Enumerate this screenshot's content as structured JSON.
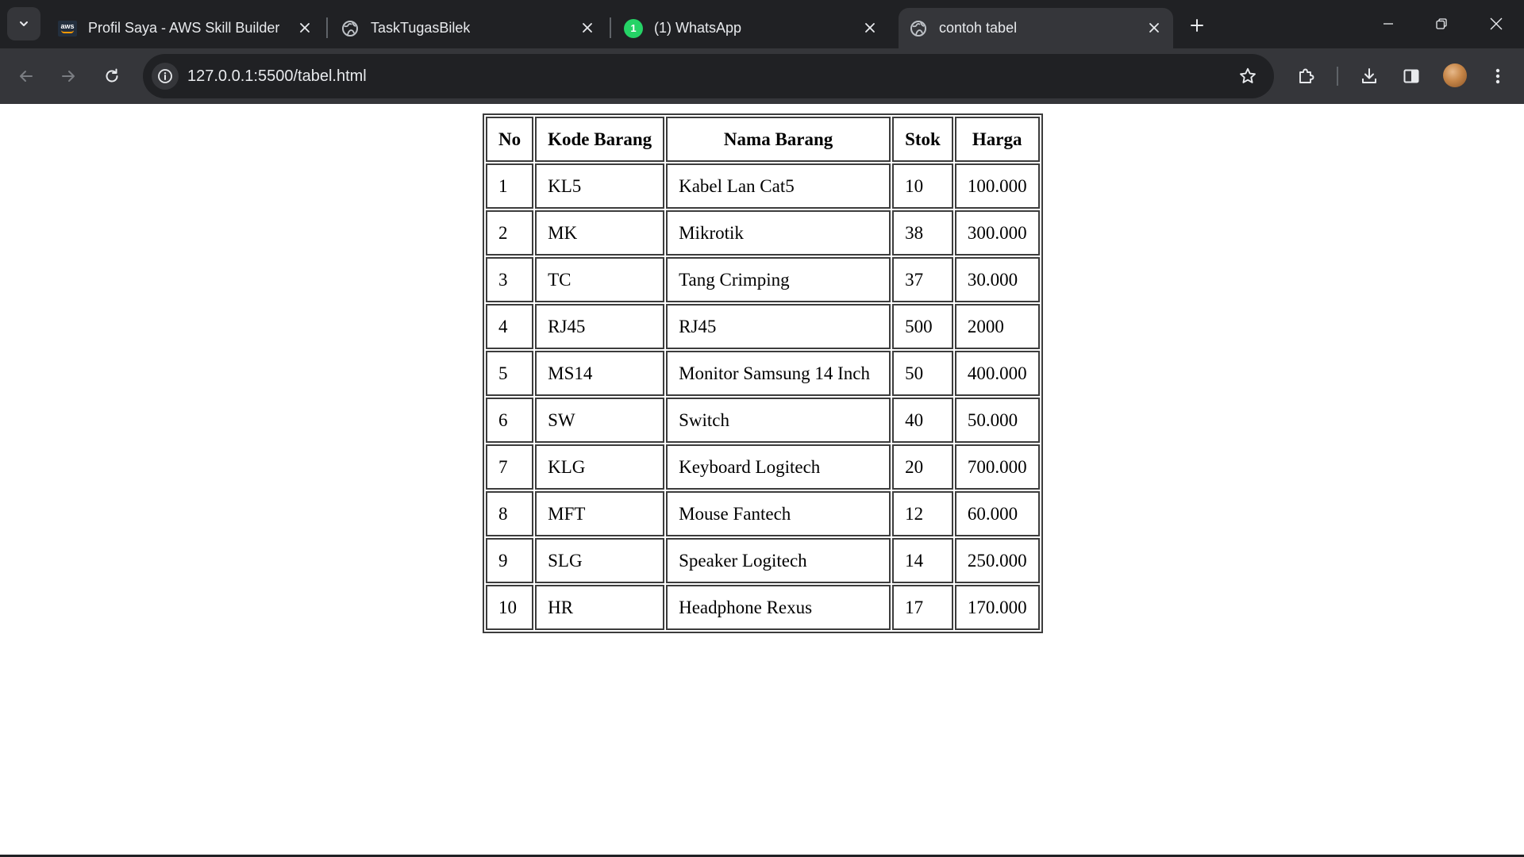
{
  "browser": {
    "tabs": [
      {
        "title": "Profil Saya - AWS Skill Builder",
        "favicon": "aws-logo-icon",
        "active": false
      },
      {
        "title": "TaskTugasBilek",
        "favicon": "globe-icon",
        "active": false
      },
      {
        "title": "(1) WhatsApp",
        "favicon": "whatsapp-icon",
        "badge": "1",
        "active": false
      },
      {
        "title": "contoh tabel",
        "favicon": "globe-icon",
        "active": true
      }
    ],
    "url": "127.0.0.1:5500/tabel.html",
    "colors": {
      "frame": "#202124",
      "toolbar": "#35363a",
      "text": "#e8eaed"
    }
  },
  "table": {
    "headers": [
      "No",
      "Kode Barang",
      "Nama Barang",
      "Stok",
      "Harga"
    ],
    "rows": [
      [
        "1",
        "KL5",
        "Kabel Lan Cat5",
        "10",
        "100.000"
      ],
      [
        "2",
        "MK",
        "Mikrotik",
        "38",
        "300.000"
      ],
      [
        "3",
        "TC",
        "Tang Crimping",
        "37",
        "30.000"
      ],
      [
        "4",
        "RJ45",
        "RJ45",
        "500",
        "2000"
      ],
      [
        "5",
        "MS14",
        "Monitor Samsung 14 Inch",
        "50",
        "400.000"
      ],
      [
        "6",
        "SW",
        "Switch",
        "40",
        "50.000"
      ],
      [
        "7",
        "KLG",
        "Keyboard Logitech",
        "20",
        "700.000"
      ],
      [
        "8",
        "MFT",
        "Mouse Fantech",
        "12",
        "60.000"
      ],
      [
        "9",
        "SLG",
        "Speaker Logitech",
        "14",
        "250.000"
      ],
      [
        "10",
        "HR",
        "Headphone Rexus",
        "17",
        "170.000"
      ]
    ]
  }
}
